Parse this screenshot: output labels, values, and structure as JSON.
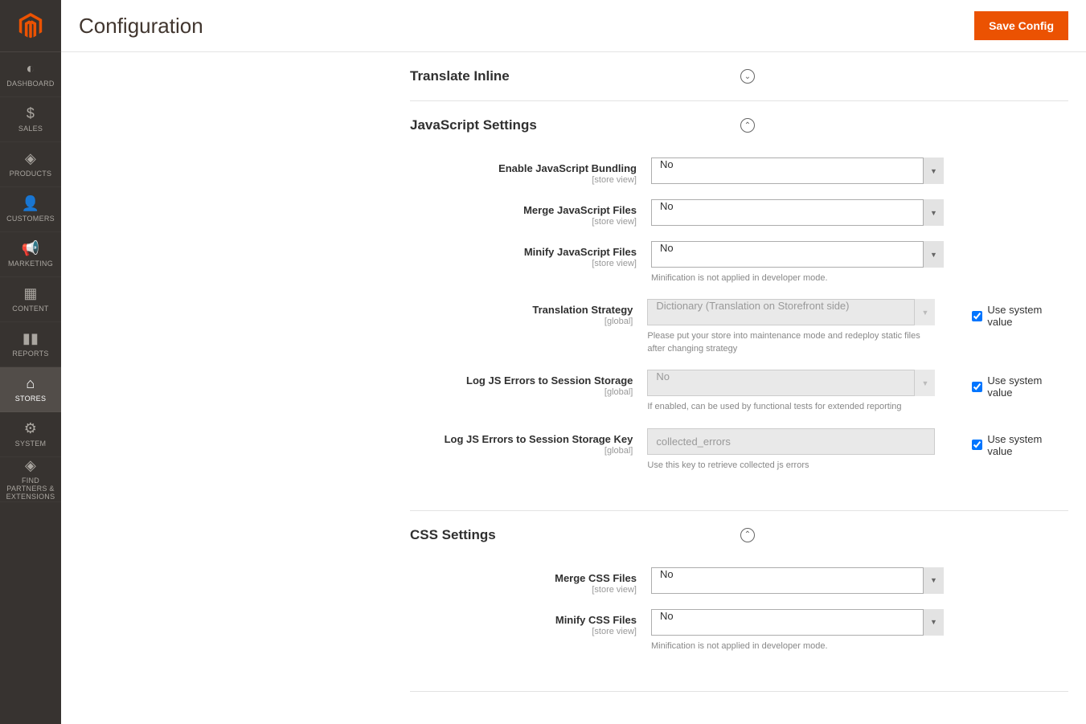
{
  "header": {
    "title": "Configuration",
    "save_button": "Save Config"
  },
  "sidebar": {
    "items": [
      {
        "label": "DASHBOARD"
      },
      {
        "label": "SALES"
      },
      {
        "label": "PRODUCTS"
      },
      {
        "label": "CUSTOMERS"
      },
      {
        "label": "MARKETING"
      },
      {
        "label": "CONTENT"
      },
      {
        "label": "REPORTS"
      },
      {
        "label": "STORES"
      },
      {
        "label": "SYSTEM"
      },
      {
        "label": "FIND PARTNERS & EXTENSIONS"
      }
    ]
  },
  "sections": {
    "translate_inline": {
      "title": "Translate Inline"
    },
    "js_settings": {
      "title": "JavaScript Settings",
      "fields": {
        "enable_bundling": {
          "label": "Enable JavaScript Bundling",
          "scope": "[store view]",
          "value": "No"
        },
        "merge_js": {
          "label": "Merge JavaScript Files",
          "scope": "[store view]",
          "value": "No"
        },
        "minify_js": {
          "label": "Minify JavaScript Files",
          "scope": "[store view]",
          "value": "No",
          "note": "Minification is not applied in developer mode."
        },
        "translation_strategy": {
          "label": "Translation Strategy",
          "scope": "[global]",
          "value": "Dictionary (Translation on Storefront side)",
          "note": "Please put your store into maintenance mode and redeploy static files after changing strategy",
          "use_system": "Use system value"
        },
        "log_errors": {
          "label": "Log JS Errors to Session Storage",
          "scope": "[global]",
          "value": "No",
          "note": "If enabled, can be used by functional tests for extended reporting",
          "use_system": "Use system value"
        },
        "log_errors_key": {
          "label": "Log JS Errors to Session Storage Key",
          "scope": "[global]",
          "value": "collected_errors",
          "note": "Use this key to retrieve collected js errors",
          "use_system": "Use system value"
        }
      }
    },
    "css_settings": {
      "title": "CSS Settings",
      "fields": {
        "merge_css": {
          "label": "Merge CSS Files",
          "scope": "[store view]",
          "value": "No"
        },
        "minify_css": {
          "label": "Minify CSS Files",
          "scope": "[store view]",
          "value": "No",
          "note": "Minification is not applied in developer mode."
        }
      }
    }
  }
}
